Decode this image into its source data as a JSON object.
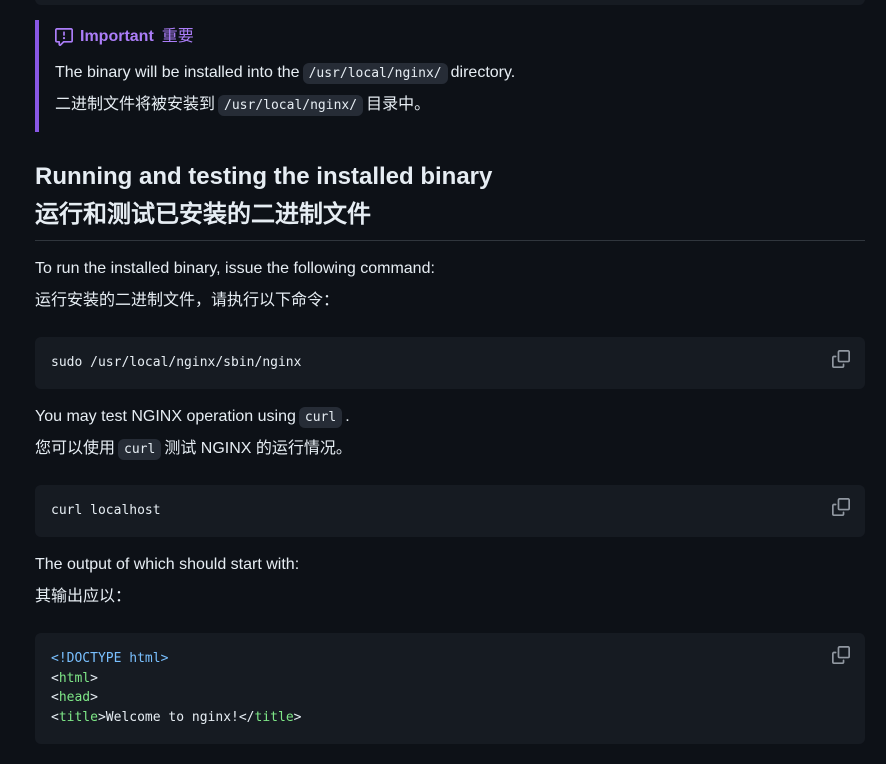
{
  "callout": {
    "icon": "report-icon",
    "title": "Important",
    "title_zh": "重要",
    "line_en_prefix": "The binary will be installed into the",
    "line_en_code": "/usr/local/nginx/",
    "line_en_suffix": "directory.",
    "line_zh_prefix": "二进制文件将被安装到",
    "line_zh_code": "/usr/local/nginx/",
    "line_zh_suffix": "目录中。"
  },
  "section": {
    "heading_en": "Running and testing the installed binary",
    "heading_zh": "运行和测试已安装的二进制文件",
    "run_en": "To run the installed binary, issue the following command:",
    "run_zh": "运行安装的二进制文件，请执行以下命令：",
    "run_command": "sudo /usr/local/nginx/sbin/nginx",
    "test_en_prefix": "You may test NGINX operation using",
    "test_en_code": "curl",
    "test_en_suffix": ".",
    "test_zh_prefix": "您可以使用",
    "test_zh_code": "curl",
    "test_zh_suffix": "测试 NGINX 的运行情况。",
    "curl_command": "curl localhost",
    "output_en": "The output of which should start with:",
    "output_zh": "其输出应以：",
    "output_lines": {
      "doctype": "<!DOCTYPE html>",
      "html_open": "<",
      "html_tag": "html",
      "html_close": ">",
      "head_open": "<",
      "head_tag": "head",
      "head_close": ">",
      "title_open": "<",
      "title_tag": "title",
      "title_mid": ">Welcome to nginx!</",
      "title_tag2": "title",
      "title_close": ">"
    }
  },
  "copy_button_icon": "copy-icon",
  "colors": {
    "background": "#0d1117",
    "code_background": "#161b22",
    "callout_accent": "#8957e5",
    "callout_title": "#ab7df8"
  }
}
